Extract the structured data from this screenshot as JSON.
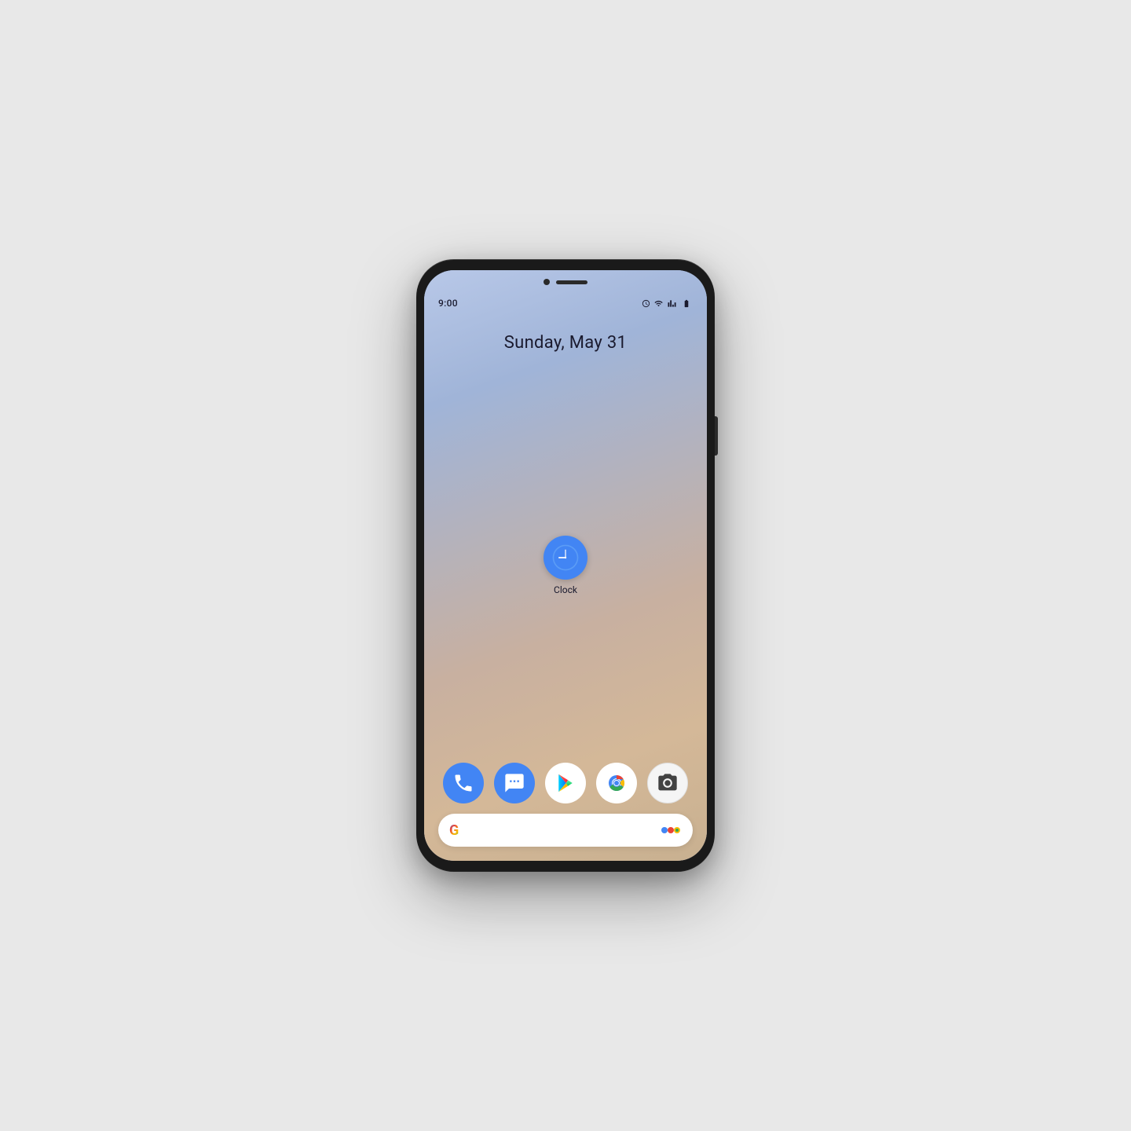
{
  "phone": {
    "status_bar": {
      "time": "9:00",
      "icons": [
        "alarm",
        "wifi",
        "signal",
        "battery"
      ]
    },
    "date": "Sunday, May 31",
    "clock_app": {
      "label": "Clock"
    },
    "search_bar": {
      "placeholder": "",
      "google_logo": "G"
    },
    "dock": {
      "apps": [
        {
          "name": "Phone",
          "icon_type": "phone"
        },
        {
          "name": "Messages",
          "icon_type": "messages"
        },
        {
          "name": "Play Store",
          "icon_type": "play"
        },
        {
          "name": "Chrome",
          "icon_type": "chrome"
        },
        {
          "name": "Camera",
          "icon_type": "camera"
        }
      ]
    }
  },
  "colors": {
    "background": "#e8e8e8",
    "phone_body": "#1a1a1a",
    "screen_gradient_top": "#b8c8e8",
    "screen_gradient_bottom": "#c8b090",
    "text_dark": "#1a1a2e",
    "blue_accent": "#4285f4"
  }
}
